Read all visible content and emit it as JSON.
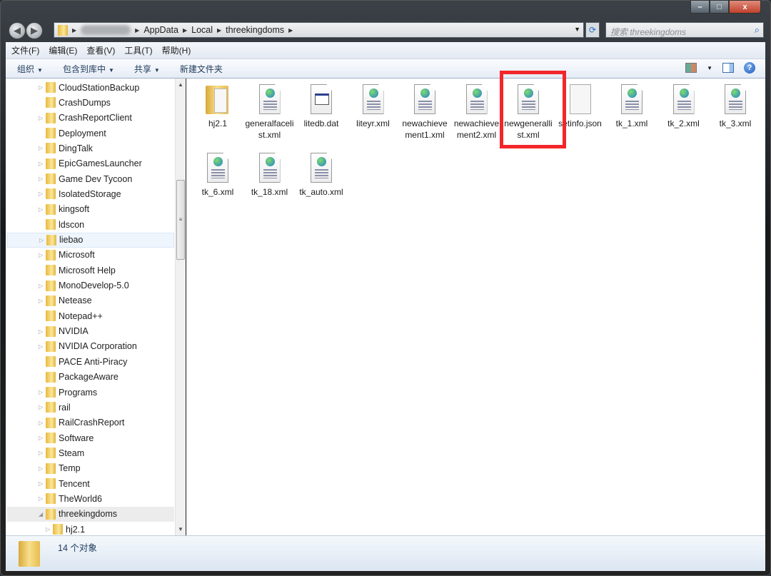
{
  "window": {
    "controls": {
      "minimize": "–",
      "maximize": "□",
      "close": "x"
    }
  },
  "address": {
    "crumbs": [
      "AppData",
      "Local",
      "threekingdoms"
    ],
    "search_placeholder": "搜索 threekingdoms"
  },
  "menu": [
    "文件(F)",
    "编辑(E)",
    "查看(V)",
    "工具(T)",
    "帮助(H)"
  ],
  "toolbar": {
    "organize": "组织",
    "include_library": "包含到库中",
    "share": "共享",
    "new_folder": "新建文件夹"
  },
  "nav": [
    {
      "label": "CloudStationBackup",
      "expand": true
    },
    {
      "label": "CrashDumps",
      "expand": false
    },
    {
      "label": "CrashReportClient",
      "expand": true
    },
    {
      "label": "Deployment",
      "expand": false
    },
    {
      "label": "DingTalk",
      "expand": true
    },
    {
      "label": "EpicGamesLauncher",
      "expand": true
    },
    {
      "label": "Game Dev Tycoon",
      "expand": true
    },
    {
      "label": "IsolatedStorage",
      "expand": true
    },
    {
      "label": "kingsoft",
      "expand": true
    },
    {
      "label": "ldscon",
      "expand": false
    },
    {
      "label": "liebao",
      "expand": true,
      "state": "hover"
    },
    {
      "label": "Microsoft",
      "expand": true
    },
    {
      "label": "Microsoft Help",
      "expand": false
    },
    {
      "label": "MonoDevelop-5.0",
      "expand": true
    },
    {
      "label": "Netease",
      "expand": true
    },
    {
      "label": "Notepad++",
      "expand": false
    },
    {
      "label": "NVIDIA",
      "expand": true
    },
    {
      "label": "NVIDIA Corporation",
      "expand": true
    },
    {
      "label": "PACE Anti-Piracy",
      "expand": false
    },
    {
      "label": "PackageAware",
      "expand": false
    },
    {
      "label": "Programs",
      "expand": true
    },
    {
      "label": "rail",
      "expand": true
    },
    {
      "label": "RailCrashReport",
      "expand": true
    },
    {
      "label": "Software",
      "expand": true
    },
    {
      "label": "Steam",
      "expand": true
    },
    {
      "label": "Temp",
      "expand": true
    },
    {
      "label": "Tencent",
      "expand": true
    },
    {
      "label": "TheWorld6",
      "expand": true
    },
    {
      "label": "threekingdoms",
      "expand": "open",
      "state": "selected"
    },
    {
      "label": "hj2.1",
      "expand": true,
      "child": true
    }
  ],
  "files": [
    {
      "name": "hj2.1",
      "type": "folder"
    },
    {
      "name": "generalfacelist.xml",
      "type": "xml"
    },
    {
      "name": "litedb.dat",
      "type": "dat"
    },
    {
      "name": "liteyr.xml",
      "type": "xml"
    },
    {
      "name": "newachievement1.xml",
      "type": "xml"
    },
    {
      "name": "newachievement2.xml",
      "type": "xml"
    },
    {
      "name": "newgenerallist.xml",
      "type": "xml",
      "highlighted": true
    },
    {
      "name": "setinfo.json",
      "type": "json"
    },
    {
      "name": "tk_1.xml",
      "type": "xml"
    },
    {
      "name": "tk_2.xml",
      "type": "xml"
    },
    {
      "name": "tk_3.xml",
      "type": "xml"
    },
    {
      "name": "tk_6.xml",
      "type": "xml"
    },
    {
      "name": "tk_18.xml",
      "type": "xml"
    },
    {
      "name": "tk_auto.xml",
      "type": "xml"
    }
  ],
  "status": {
    "count": "14 个对象"
  },
  "colors": {
    "highlight": "#f2262b"
  }
}
